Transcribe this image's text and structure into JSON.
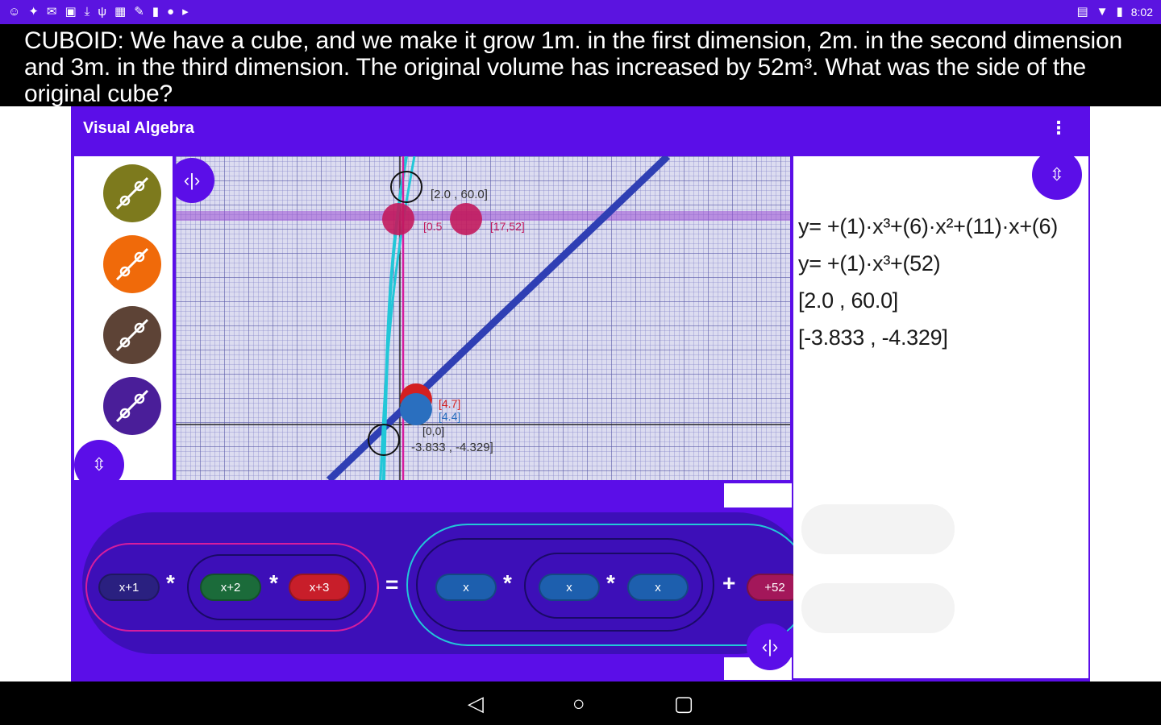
{
  "status_bar": {
    "left_icons": [
      "chat-icon",
      "bird-icon",
      "mail-icon",
      "notification-icon",
      "download-icon",
      "usb-icon",
      "image-icon",
      "wrench-icon",
      "pin-icon",
      "location-icon",
      "play-icon"
    ],
    "right_icons": [
      "screen-icon",
      "wifi-icon",
      "battery-icon"
    ],
    "time": "8:02"
  },
  "question": "CUBOID: We have a cube, and we make it grow 1m. in the first dimension, 2m. in the second dimension and 3m. in the third dimension. The original volume has increased by 52m³. What was the side of the original cube?",
  "app": {
    "title": "Visual Algebra",
    "overflow_label": "⋮",
    "tools": [
      {
        "name": "olive-line-tool",
        "color": "#7d7a1d"
      },
      {
        "name": "orange-line-tool",
        "color": "#f06a0a"
      },
      {
        "name": "brown-line-tool",
        "color": "#5d4336"
      },
      {
        "name": "purple-line-tool",
        "color": "#4a1e99"
      }
    ],
    "colors": {
      "primary": "#5b0ee8",
      "builder_band": "#3d0fb8",
      "grid_bg": "#dcdcf0",
      "grid_line": "#8a8acc",
      "line_dark_blue": "#2f3fb4",
      "cyan": "#22c7d8",
      "magenta": "#d61d9e"
    },
    "graph": {
      "labels": {
        "point_top": "[2.0 , 60.0]",
        "point_a": "[0.5",
        "point_b": "[17,52]",
        "point_c": "[4.7]",
        "point_d": "[4.4]",
        "point_e": "[0,0]",
        "point_f": "-3.833 , -4.329]"
      }
    },
    "equations": [
      "y= +(1)·x³+(6)·x²+(11)·x+(6)",
      "y= +(1)·x³+(52)",
      "[2.0 , 60.0]",
      "[-3.833 , -4.329]"
    ],
    "builder": {
      "left": [
        {
          "label": "x+1",
          "color": "#2a2080"
        },
        {
          "label": "x+2",
          "color": "#1b6b3a"
        },
        {
          "label": "x+3",
          "color": "#c81e2a"
        }
      ],
      "right": [
        {
          "label": "x",
          "color": "#1d5fae"
        },
        {
          "label": "x",
          "color": "#1d5fae"
        },
        {
          "label": "x",
          "color": "#1d5fae"
        }
      ],
      "constant": {
        "label": "+52",
        "color": "#a3175a"
      },
      "times": "*",
      "equals": "=",
      "plus": "+"
    }
  },
  "nav": {
    "back": "◁",
    "home": "○",
    "recents": "▢"
  }
}
